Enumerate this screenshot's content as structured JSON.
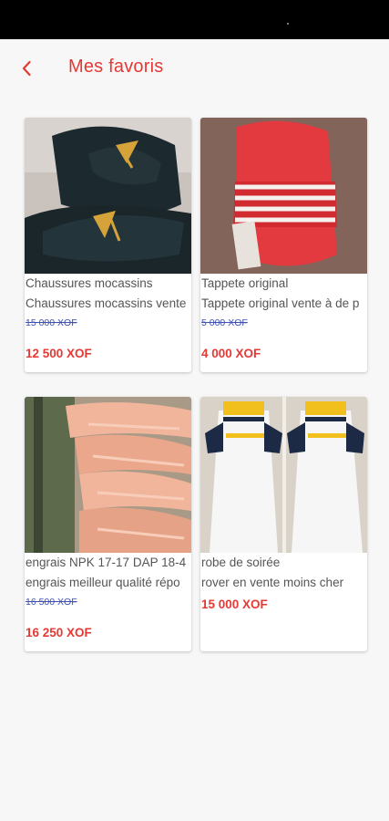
{
  "header": {
    "title": "Mes favoris",
    "back_icon": "chevron-left-icon",
    "accent_color": "#e53935"
  },
  "products": [
    {
      "name": "Chaussures mocassins",
      "description": "Chaussures mocassins vente",
      "old_price": "15 000 XOF",
      "price": "12 500 XOF",
      "image": "black-loafers-photo"
    },
    {
      "name": "Tappete original",
      "description": "Tappete original vente à de p",
      "old_price": "5 000 XOF",
      "price": "4 000 XOF",
      "image": "red-slides-photo"
    },
    {
      "name": "engrais NPK 17-17 DAP 18-4",
      "description": "engrais meilleur qualité répo",
      "old_price": "16 500 XOF",
      "price": "16 250 XOF",
      "image": "fertilizer-bags-photo"
    },
    {
      "name": "robe de soirée",
      "description": "rover en vente moins cher",
      "old_price": "",
      "price": "15 000 XOF",
      "image": "white-dress-photo"
    }
  ]
}
